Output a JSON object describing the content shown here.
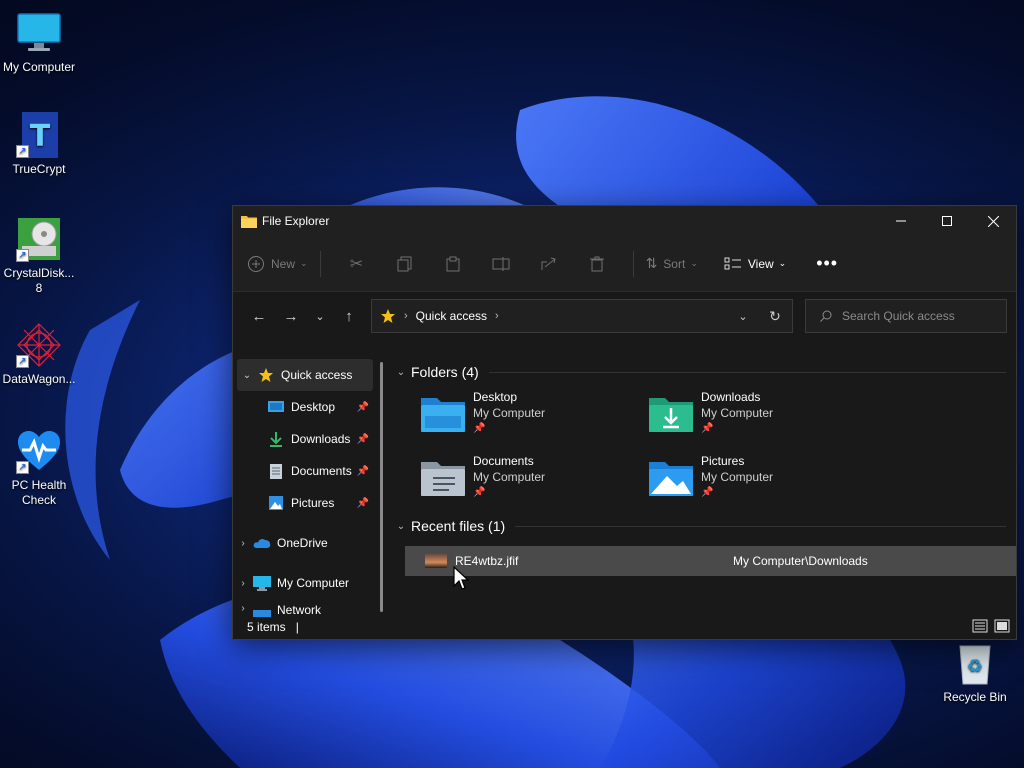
{
  "desktop": {
    "icons": [
      {
        "label": "My Computer"
      },
      {
        "label": "TrueCrypt"
      },
      {
        "label": "CrystalDisk... 8"
      },
      {
        "label": "DataWagon..."
      },
      {
        "label": "PC Health Check"
      },
      {
        "label": "Recycle Bin"
      }
    ]
  },
  "window": {
    "title": "File Explorer",
    "toolbar": {
      "new_label": "New",
      "sort_label": "Sort",
      "view_label": "View"
    },
    "address": {
      "crumb": "Quick access"
    },
    "search": {
      "placeholder": "Search Quick access"
    },
    "sidebar": {
      "items": [
        {
          "label": "Quick access"
        },
        {
          "label": "Desktop"
        },
        {
          "label": "Downloads"
        },
        {
          "label": "Documents"
        },
        {
          "label": "Pictures"
        },
        {
          "label": "OneDrive"
        },
        {
          "label": "My Computer"
        },
        {
          "label": "Network"
        }
      ]
    },
    "folders_header": "Folders (4)",
    "folders": [
      {
        "name": "Desktop",
        "location": "My Computer"
      },
      {
        "name": "Downloads",
        "location": "My Computer"
      },
      {
        "name": "Documents",
        "location": "My Computer"
      },
      {
        "name": "Pictures",
        "location": "My Computer"
      }
    ],
    "recent_header": "Recent files (1)",
    "recent_files": [
      {
        "name": "RE4wtbz.jfif",
        "location": "My Computer\\Downloads"
      }
    ],
    "status": {
      "items_count": "5 items"
    }
  },
  "colors": {
    "accent": "#0078d4",
    "folder_blue": "#3aa0e8",
    "star": "#f3c019"
  }
}
